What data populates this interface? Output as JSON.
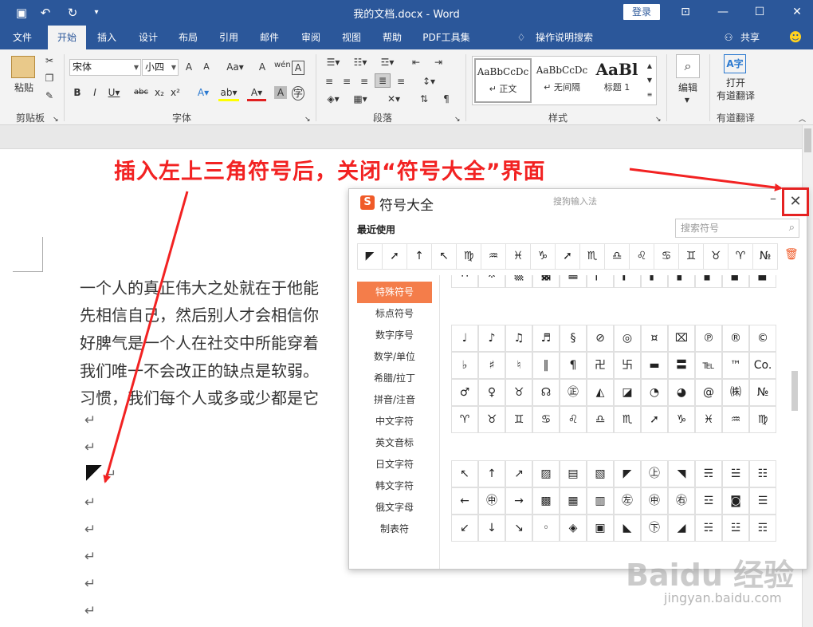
{
  "titlebar": {
    "title": "我的文档.docx  -  Word",
    "login": "登录",
    "quick_access": [
      "save-icon",
      "undo-icon",
      "redo-icon",
      "customize-icon"
    ],
    "window_controls": [
      "ribbon-display-icon",
      "minimize-icon",
      "maximize-icon",
      "close-icon"
    ]
  },
  "menu": {
    "tabs": [
      "文件",
      "开始",
      "插入",
      "设计",
      "布局",
      "引用",
      "邮件",
      "审阅",
      "视图",
      "帮助",
      "PDF工具集"
    ],
    "active": "开始",
    "tell_me": "操作说明搜索",
    "share": "共享"
  },
  "ribbon": {
    "clipboard": {
      "paste": "粘贴",
      "label": "剪贴板"
    },
    "font": {
      "name": "宋体",
      "size": "小四",
      "label": "字体"
    },
    "paragraph": {
      "label": "段落"
    },
    "styles": {
      "label": "样式",
      "items": [
        {
          "sample": "AaBbCcDc",
          "name": "↵ 正文"
        },
        {
          "sample": "AaBbCcDc",
          "name": "↵ 无间隔"
        },
        {
          "sample": "AaBl",
          "name": "标题 1"
        }
      ]
    },
    "editing": {
      "label": "编辑"
    },
    "translate": {
      "button": "打开\n有道翻译",
      "label": "有道翻译"
    }
  },
  "document": {
    "paragraphs": [
      "一个人的真正伟大之处就在于他能",
      "先相信自己，然后别人才会相信你",
      "好脾气是一个人在社交中所能穿着",
      "我们唯一不会改正的缺点是软弱。",
      "习惯，我们每个人或多或少都是它"
    ],
    "return_mark": "↵"
  },
  "annotation": {
    "text": "插入左上三角符号后，关闭“符号大全”界面",
    "color": "#f22222"
  },
  "dialog": {
    "title": "符号大全",
    "brand": "搜狗输入法",
    "logo_letter": "S",
    "recent_label": "最近使用",
    "search_placeholder": "搜索符号",
    "recent": [
      "◤",
      "➚",
      "↑",
      "↖",
      "♍",
      "♒",
      "♓",
      "♑",
      "➚",
      "♏",
      "♎",
      "♌",
      "♋",
      "♊",
      "♉",
      "♈",
      "№"
    ],
    "categories": [
      "特殊符号",
      "标点符号",
      "数字序号",
      "数学/单位",
      "希腊/拉丁",
      "拼音/注音",
      "中文字符",
      "英文音标",
      "日文字符",
      "韩文字符",
      "俄文字母",
      "制表符"
    ],
    "active_category": "特殊符号",
    "grid_top": [
      "∴",
      "※",
      "▒",
      "▓",
      "▦",
      "▏",
      "▎",
      "▍",
      "▌",
      "▋",
      "▊",
      "▉"
    ],
    "grid_mid": [
      [
        "♩",
        "♪",
        "♫",
        "♬",
        "§",
        "⊘",
        "◎",
        "¤",
        "⌧",
        "℗",
        "®",
        "©"
      ],
      [
        "♭",
        "♯",
        "♮",
        "‖",
        "¶",
        "卍",
        "卐",
        "▬",
        "〓",
        "℡",
        "™",
        "Co."
      ],
      [
        "♂",
        "♀",
        "♉",
        "☊",
        "㊣",
        "◭",
        "◪",
        "◔",
        "◕",
        "@",
        "㈱",
        "№"
      ],
      [
        "♈",
        "♉",
        "♊",
        "♋",
        "♌",
        "♎",
        "♏",
        "➚",
        "♑",
        "♓",
        "♒",
        "♍"
      ]
    ],
    "grid_bottom": [
      [
        "↖",
        "↑",
        "↗",
        "▨",
        "▤",
        "▧",
        "◤",
        "㊤",
        "◥",
        "☴",
        "☱",
        "☷"
      ],
      [
        "←",
        "㊥",
        "→",
        "▩",
        "▦",
        "▥",
        "㊧",
        "㊥",
        "㊨",
        "☲",
        "◙",
        "☰"
      ],
      [
        "↙",
        "↓",
        "↘",
        "◦",
        "◈",
        "▣",
        "◣",
        "㊦",
        "◢",
        "☵",
        "☳",
        "☶"
      ]
    ]
  },
  "watermark": {
    "brand": "Baidu 经验",
    "site": "jingyan.baidu.com"
  }
}
